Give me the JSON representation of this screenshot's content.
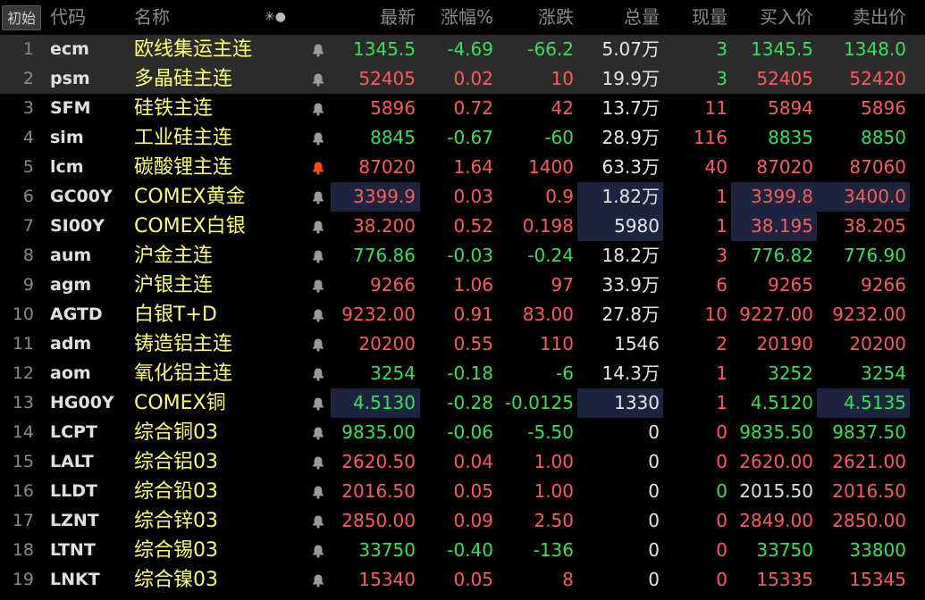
{
  "header": {
    "init_button": "初始",
    "code": "代码",
    "name": "名称",
    "icons": "✳●",
    "last": "最新",
    "pct": "涨幅%",
    "change": "涨跌",
    "volume": "总量",
    "current_volume": "现量",
    "bid": "买入价",
    "ask": "卖出价"
  },
  "colors": {
    "up": "#ff5a5a",
    "down": "#38e05a",
    "flat": "#dedede",
    "name": "#ffff70",
    "alert_active": "#ff4a1c"
  },
  "rows": [
    {
      "idx": "1",
      "code": "ecm",
      "name": "欧线集运主连",
      "last": "1345.5",
      "pct": "-4.69",
      "chg": "-66.2",
      "vol": "5.07",
      "unit": "万",
      "cur": "3",
      "bid": "1345.5",
      "ask": "1348.0",
      "dir": "down",
      "cur_dir": "down",
      "bid_dir": "down",
      "ask_dir": "down",
      "highlight": true,
      "alert": false
    },
    {
      "idx": "2",
      "code": "psm",
      "name": "多晶硅主连",
      "last": "52405",
      "pct": "0.02",
      "chg": "10",
      "vol": "19.9",
      "unit": "万",
      "cur": "3",
      "bid": "52405",
      "ask": "52420",
      "dir": "up",
      "cur_dir": "down",
      "bid_dir": "up",
      "ask_dir": "up",
      "highlight": true,
      "alert": false
    },
    {
      "idx": "3",
      "code": "SFM",
      "name": "硅铁主连",
      "last": "5896",
      "pct": "0.72",
      "chg": "42",
      "vol": "13.7",
      "unit": "万",
      "cur": "11",
      "bid": "5894",
      "ask": "5896",
      "dir": "up",
      "cur_dir": "up",
      "bid_dir": "up",
      "ask_dir": "up",
      "alert": false
    },
    {
      "idx": "4",
      "code": "sim",
      "name": "工业硅主连",
      "last": "8845",
      "pct": "-0.67",
      "chg": "-60",
      "vol": "28.9",
      "unit": "万",
      "cur": "116",
      "bid": "8835",
      "ask": "8850",
      "dir": "down",
      "cur_dir": "up",
      "bid_dir": "down",
      "ask_dir": "down",
      "alert": false
    },
    {
      "idx": "5",
      "code": "lcm",
      "name": "碳酸锂主连",
      "last": "87020",
      "pct": "1.64",
      "chg": "1400",
      "vol": "63.3",
      "unit": "万",
      "cur": "40",
      "bid": "87020",
      "ask": "87060",
      "dir": "up",
      "cur_dir": "up",
      "bid_dir": "up",
      "ask_dir": "up",
      "alert": true
    },
    {
      "idx": "6",
      "code": "GC00Y",
      "name": "COMEX黄金",
      "last": "3399.9",
      "pct": "0.03",
      "chg": "0.9",
      "vol": "1.82",
      "unit": "万",
      "cur": "1",
      "bid": "3399.8",
      "ask": "3400.0",
      "dir": "up",
      "cur_dir": "up",
      "bid_dir": "up",
      "ask_dir": "up",
      "boxes": [
        "last",
        "vol",
        "bid",
        "ask"
      ],
      "alert": false
    },
    {
      "idx": "7",
      "code": "SI00Y",
      "name": "COMEX白银",
      "last": "38.200",
      "pct": "0.52",
      "chg": "0.198",
      "vol": "5980",
      "unit": "",
      "cur": "1",
      "bid": "38.195",
      "ask": "38.205",
      "dir": "up",
      "cur_dir": "up",
      "bid_dir": "up",
      "ask_dir": "up",
      "boxes": [
        "vol",
        "bid"
      ],
      "alert": false
    },
    {
      "idx": "8",
      "code": "aum",
      "name": "沪金主连",
      "last": "776.86",
      "pct": "-0.03",
      "chg": "-0.24",
      "vol": "18.2",
      "unit": "万",
      "cur": "3",
      "bid": "776.82",
      "ask": "776.90",
      "dir": "down",
      "cur_dir": "up",
      "bid_dir": "down",
      "ask_dir": "down",
      "alert": false
    },
    {
      "idx": "9",
      "code": "agm",
      "name": "沪银主连",
      "last": "9266",
      "pct": "1.06",
      "chg": "97",
      "vol": "33.9",
      "unit": "万",
      "cur": "6",
      "bid": "9265",
      "ask": "9266",
      "dir": "up",
      "cur_dir": "up",
      "bid_dir": "up",
      "ask_dir": "up",
      "alert": false
    },
    {
      "idx": "10",
      "code": "AGTD",
      "name": "白银T+D",
      "last": "9232.00",
      "pct": "0.91",
      "chg": "83.00",
      "vol": "27.8",
      "unit": "万",
      "cur": "10",
      "bid": "9227.00",
      "ask": "9232.00",
      "dir": "up",
      "cur_dir": "up",
      "bid_dir": "up",
      "ask_dir": "up",
      "alert": false
    },
    {
      "idx": "11",
      "code": "adm",
      "name": "铸造铝主连",
      "last": "20200",
      "pct": "0.55",
      "chg": "110",
      "vol": "1546",
      "unit": "",
      "cur": "2",
      "bid": "20190",
      "ask": "20200",
      "dir": "up",
      "cur_dir": "up",
      "bid_dir": "up",
      "ask_dir": "up",
      "alert": false
    },
    {
      "idx": "12",
      "code": "aom",
      "name": "氧化铝主连",
      "last": "3254",
      "pct": "-0.18",
      "chg": "-6",
      "vol": "14.3",
      "unit": "万",
      "cur": "1",
      "bid": "3252",
      "ask": "3254",
      "dir": "down",
      "cur_dir": "up",
      "bid_dir": "down",
      "ask_dir": "down",
      "alert": false
    },
    {
      "idx": "13",
      "code": "HG00Y",
      "name": "COMEX铜",
      "last": "4.5130",
      "pct": "-0.28",
      "chg": "-0.0125",
      "vol": "1330",
      "unit": "",
      "cur": "1",
      "bid": "4.5120",
      "ask": "4.5135",
      "dir": "down",
      "cur_dir": "up",
      "bid_dir": "down",
      "ask_dir": "down",
      "boxes": [
        "last",
        "vol",
        "ask"
      ],
      "alert": false
    },
    {
      "idx": "14",
      "code": "LCPT",
      "name": "综合铜03",
      "last": "9835.00",
      "pct": "-0.06",
      "chg": "-5.50",
      "vol": "0",
      "unit": "",
      "cur": "0",
      "bid": "9835.50",
      "ask": "9837.50",
      "dir": "down",
      "cur_dir": "up",
      "bid_dir": "down",
      "ask_dir": "down",
      "alert": false
    },
    {
      "idx": "15",
      "code": "LALT",
      "name": "综合铝03",
      "last": "2620.50",
      "pct": "0.04",
      "chg": "1.00",
      "vol": "0",
      "unit": "",
      "cur": "0",
      "bid": "2620.00",
      "ask": "2621.00",
      "dir": "up",
      "cur_dir": "up",
      "bid_dir": "up",
      "ask_dir": "up",
      "alert": false
    },
    {
      "idx": "16",
      "code": "LLDT",
      "name": "综合铅03",
      "last": "2016.50",
      "pct": "0.05",
      "chg": "1.00",
      "vol": "0",
      "unit": "",
      "cur": "0",
      "bid": "2015.50",
      "ask": "2016.50",
      "dir": "up",
      "cur_dir": "down",
      "bid_dir": "flat",
      "ask_dir": "up",
      "alert": false
    },
    {
      "idx": "17",
      "code": "LZNT",
      "name": "综合锌03",
      "last": "2850.00",
      "pct": "0.09",
      "chg": "2.50",
      "vol": "0",
      "unit": "",
      "cur": "0",
      "bid": "2849.00",
      "ask": "2850.00",
      "dir": "up",
      "cur_dir": "up",
      "bid_dir": "up",
      "ask_dir": "up",
      "alert": false
    },
    {
      "idx": "18",
      "code": "LTNT",
      "name": "综合锡03",
      "last": "33750",
      "pct": "-0.40",
      "chg": "-136",
      "vol": "0",
      "unit": "",
      "cur": "0",
      "bid": "33750",
      "ask": "33800",
      "dir": "down",
      "cur_dir": "up",
      "bid_dir": "down",
      "ask_dir": "down",
      "alert": false
    },
    {
      "idx": "19",
      "code": "LNKT",
      "name": "综合镍03",
      "last": "15340",
      "pct": "0.05",
      "chg": "8",
      "vol": "0",
      "unit": "",
      "cur": "0",
      "bid": "15335",
      "ask": "15345",
      "dir": "up",
      "cur_dir": "up",
      "bid_dir": "up",
      "ask_dir": "up",
      "alert": false
    }
  ]
}
